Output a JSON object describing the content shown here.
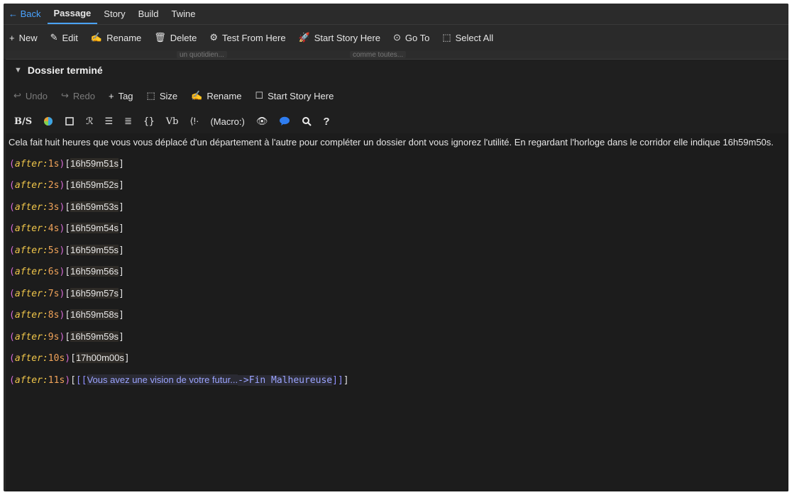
{
  "topbar": {
    "back": "← Back",
    "tabs": [
      "Passage",
      "Story",
      "Build",
      "Twine"
    ]
  },
  "toolbar": {
    "items": [
      {
        "icon": "+",
        "label": "New"
      },
      {
        "icon": "✎",
        "label": "Edit"
      },
      {
        "icon": "✍",
        "label": "Rename"
      },
      {
        "icon": "🗑",
        "label": "Delete"
      },
      {
        "icon": "⚙",
        "label": "Test From Here"
      },
      {
        "icon": "🚀",
        "label": "Start Story Here"
      },
      {
        "icon": "⊙",
        "label": "Go To"
      },
      {
        "icon": "⬚",
        "label": "Select All"
      }
    ]
  },
  "map": {
    "ghost1": "un quotidien...",
    "ghost2": "comme toutes..."
  },
  "dialog": {
    "title": "Dossier terminé",
    "tools": [
      {
        "icon": "↩",
        "label": "Undo"
      },
      {
        "icon": "↪",
        "label": "Redo"
      },
      {
        "icon": "+",
        "label": "Tag"
      },
      {
        "icon": "⬚",
        "label": "Size"
      },
      {
        "icon": "✍",
        "label": "Rename"
      },
      {
        "icon": "☐",
        "label": "Start Story Here"
      }
    ],
    "harlowe": [
      "B/S",
      "(Macro:)"
    ]
  },
  "passage": {
    "prose": "Cela fait huit heures que vous vous déplacé d'un département à l'autre pour compléter un dossier dont vous ignorez l'utilité. En regardant l'horloge dans le corridor elle indique 16h59m50s.",
    "lines": [
      {
        "arg": "1s",
        "text": "16h59m51s"
      },
      {
        "arg": "2s",
        "text": "16h59m52s"
      },
      {
        "arg": "3s",
        "text": "16h59m53s"
      },
      {
        "arg": "4s",
        "text": "16h59m54s"
      },
      {
        "arg": "5s",
        "text": "16h59m55s"
      },
      {
        "arg": "6s",
        "text": "16h59m56s"
      },
      {
        "arg": "7s",
        "text": "16h59m57s"
      },
      {
        "arg": "8s",
        "text": "16h59m58s"
      },
      {
        "arg": "9s",
        "text": "16h59m59s"
      },
      {
        "arg": "10s",
        "text": "17h00m00s"
      }
    ],
    "macro": "after:",
    "last": {
      "arg": "11s",
      "link_text": "Vous avez une vision de votre futur...",
      "arrow": "->",
      "dest": "Fin Malheureuse"
    }
  }
}
